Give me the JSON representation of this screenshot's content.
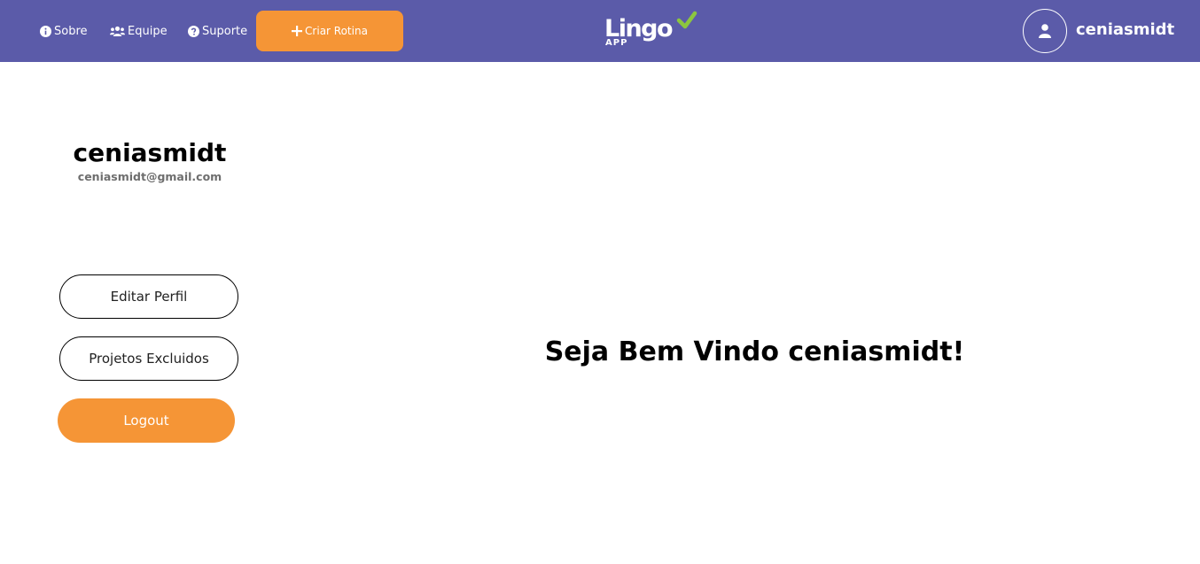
{
  "navbar": {
    "links": [
      {
        "label": "Sobre",
        "icon": "info-circle-icon"
      },
      {
        "label": "Equipe",
        "icon": "users-icon"
      },
      {
        "label": "Suporte",
        "icon": "question-circle-icon"
      }
    ],
    "create_button": {
      "label": "Criar Rotina",
      "icon": "plus-icon"
    },
    "logo": {
      "main": "Lingo",
      "sub": "APP",
      "icon": "check-icon",
      "accent": "#8cc63f"
    },
    "user": {
      "avatar_icon": "user-icon",
      "username": "ceniasmidt"
    },
    "background_color": "#5b5ba9"
  },
  "profile": {
    "name": "ceniasmidt",
    "email": "ceniasmidt@gmail.com"
  },
  "sidebar": {
    "edit_profile_label": "Editar Perfil",
    "deleted_projects_label": "Projetos Excluidos",
    "logout_label": "Logout"
  },
  "main": {
    "welcome_text": "Seja Bem Vindo ceniasmidt!"
  },
  "colors": {
    "accent": "#f59536",
    "primary": "#5b5ba9"
  }
}
